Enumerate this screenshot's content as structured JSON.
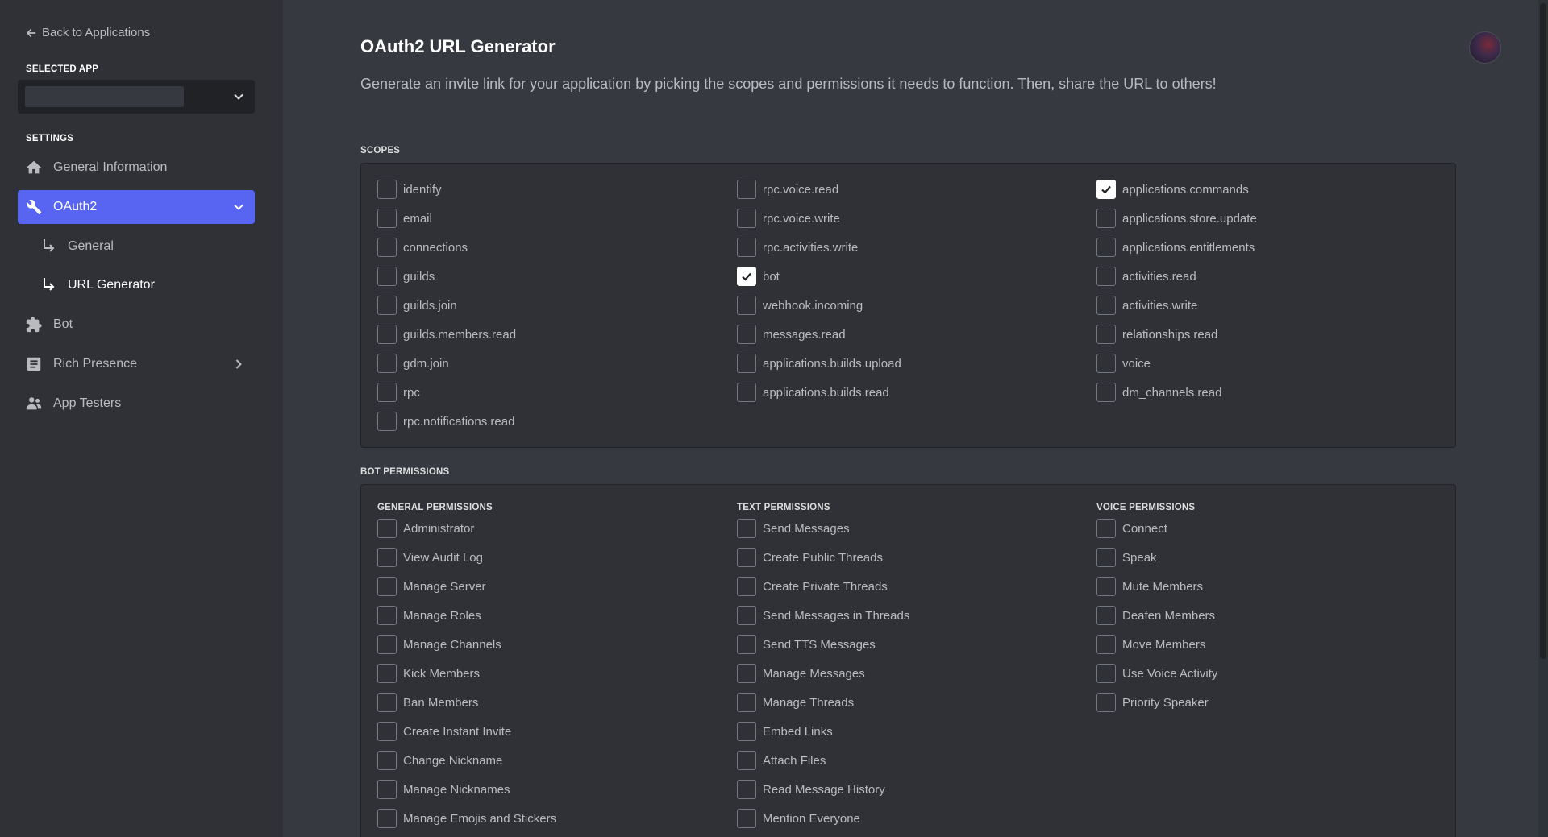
{
  "sidebar": {
    "back_label": "Back to Applications",
    "selected_app_heading": "SELECTED APP",
    "settings_heading": "SETTINGS",
    "items": [
      {
        "label": "General Information",
        "icon": "home-icon"
      },
      {
        "label": "OAuth2",
        "icon": "wrench-icon",
        "active": true
      },
      {
        "label": "Bot",
        "icon": "puzzle-icon"
      },
      {
        "label": "Rich Presence",
        "icon": "document-icon"
      },
      {
        "label": "App Testers",
        "icon": "users-icon"
      }
    ],
    "sub_items": [
      {
        "label": "General"
      },
      {
        "label": "URL Generator",
        "active": true
      }
    ]
  },
  "main": {
    "title": "OAuth2 URL Generator",
    "description": "Generate an invite link for your application by picking the scopes and permissions it needs to function. Then, share the URL to others!",
    "scopes_heading": "SCOPES",
    "scopes": [
      [
        {
          "label": "identify",
          "checked": false
        },
        {
          "label": "email",
          "checked": false
        },
        {
          "label": "connections",
          "checked": false
        },
        {
          "label": "guilds",
          "checked": false
        },
        {
          "label": "guilds.join",
          "checked": false
        },
        {
          "label": "guilds.members.read",
          "checked": false
        },
        {
          "label": "gdm.join",
          "checked": false
        },
        {
          "label": "rpc",
          "checked": false
        },
        {
          "label": "rpc.notifications.read",
          "checked": false
        }
      ],
      [
        {
          "label": "rpc.voice.read",
          "checked": false
        },
        {
          "label": "rpc.voice.write",
          "checked": false
        },
        {
          "label": "rpc.activities.write",
          "checked": false
        },
        {
          "label": "bot",
          "checked": true
        },
        {
          "label": "webhook.incoming",
          "checked": false
        },
        {
          "label": "messages.read",
          "checked": false
        },
        {
          "label": "applications.builds.upload",
          "checked": false
        },
        {
          "label": "applications.builds.read",
          "checked": false
        }
      ],
      [
        {
          "label": "applications.commands",
          "checked": true
        },
        {
          "label": "applications.store.update",
          "checked": false
        },
        {
          "label": "applications.entitlements",
          "checked": false
        },
        {
          "label": "activities.read",
          "checked": false
        },
        {
          "label": "activities.write",
          "checked": false
        },
        {
          "label": "relationships.read",
          "checked": false
        },
        {
          "label": "voice",
          "checked": false
        },
        {
          "label": "dm_channels.read",
          "checked": false
        }
      ]
    ],
    "bot_permissions_heading": "BOT PERMISSIONS",
    "permission_groups": [
      {
        "heading": "GENERAL PERMISSIONS",
        "items": [
          {
            "label": "Administrator",
            "checked": false
          },
          {
            "label": "View Audit Log",
            "checked": false
          },
          {
            "label": "Manage Server",
            "checked": false
          },
          {
            "label": "Manage Roles",
            "checked": false
          },
          {
            "label": "Manage Channels",
            "checked": false
          },
          {
            "label": "Kick Members",
            "checked": false
          },
          {
            "label": "Ban Members",
            "checked": false
          },
          {
            "label": "Create Instant Invite",
            "checked": false
          },
          {
            "label": "Change Nickname",
            "checked": false
          },
          {
            "label": "Manage Nicknames",
            "checked": false
          },
          {
            "label": "Manage Emojis and Stickers",
            "checked": false
          }
        ]
      },
      {
        "heading": "TEXT PERMISSIONS",
        "items": [
          {
            "label": "Send Messages",
            "checked": false
          },
          {
            "label": "Create Public Threads",
            "checked": false
          },
          {
            "label": "Create Private Threads",
            "checked": false
          },
          {
            "label": "Send Messages in Threads",
            "checked": false
          },
          {
            "label": "Send TTS Messages",
            "checked": false
          },
          {
            "label": "Manage Messages",
            "checked": false
          },
          {
            "label": "Manage Threads",
            "checked": false
          },
          {
            "label": "Embed Links",
            "checked": false
          },
          {
            "label": "Attach Files",
            "checked": false
          },
          {
            "label": "Read Message History",
            "checked": false
          },
          {
            "label": "Mention Everyone",
            "checked": false
          }
        ]
      },
      {
        "heading": "VOICE PERMISSIONS",
        "items": [
          {
            "label": "Connect",
            "checked": false
          },
          {
            "label": "Speak",
            "checked": false
          },
          {
            "label": "Mute Members",
            "checked": false
          },
          {
            "label": "Deafen Members",
            "checked": false
          },
          {
            "label": "Move Members",
            "checked": false
          },
          {
            "label": "Use Voice Activity",
            "checked": false
          },
          {
            "label": "Priority Speaker",
            "checked": false
          }
        ]
      }
    ]
  },
  "colors": {
    "accent": "#5865f2",
    "sidebar_bg": "#2f3136",
    "main_bg": "#36393f",
    "panel_bg": "#2f3136"
  }
}
